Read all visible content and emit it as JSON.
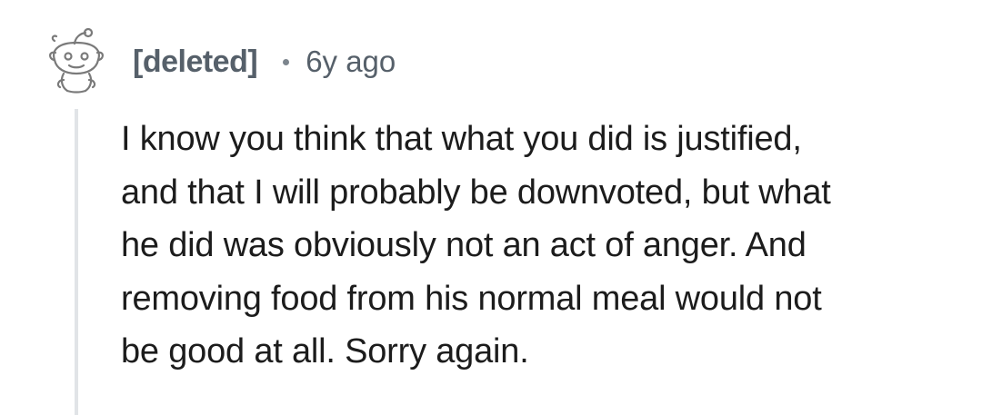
{
  "comment": {
    "author": "[deleted]",
    "timestamp": "6y ago",
    "avatar_icon": "snoo-avatar-icon",
    "body_lines": [
      "I know you think that what you did is justified,",
      "and that I will probably be downvoted, but what",
      "he did was obviously not an act of anger. And",
      "removing food from his normal meal would not",
      "be good at all. Sorry again."
    ]
  },
  "colors": {
    "author_text": "#56606a",
    "body_text": "#1c1c1c",
    "thread_line": "#e1e4e7",
    "avatar_stroke": "#7a7a7a"
  }
}
